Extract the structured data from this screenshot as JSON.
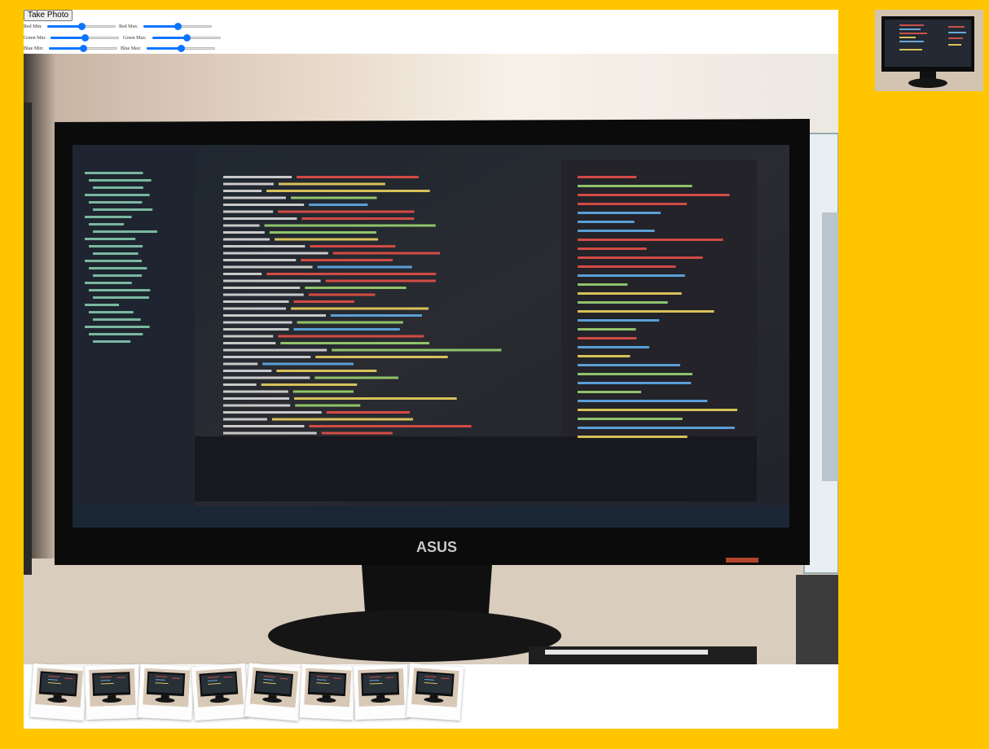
{
  "controls": {
    "take_photo_label": "Take Photo",
    "sliders": [
      {
        "id": "red-min",
        "label": "Red Min:",
        "value": 0.5
      },
      {
        "id": "red-max",
        "label": "Red Max:",
        "value": 0.5
      },
      {
        "id": "green-min",
        "label": "Green Min:",
        "value": 0.5
      },
      {
        "id": "green-max",
        "label": "Green Max:",
        "value": 0.5
      },
      {
        "id": "blue-min",
        "label": "Blue Min:",
        "value": 0.5
      },
      {
        "id": "blue-max",
        "label": "Blue Max:",
        "value": 0.5
      }
    ]
  },
  "video": {
    "monitor_brand": "ASUS"
  },
  "gallery": {
    "count": 8
  },
  "colors": {
    "page_background": "#ffc600",
    "slider_accent": "#0a75ff"
  }
}
